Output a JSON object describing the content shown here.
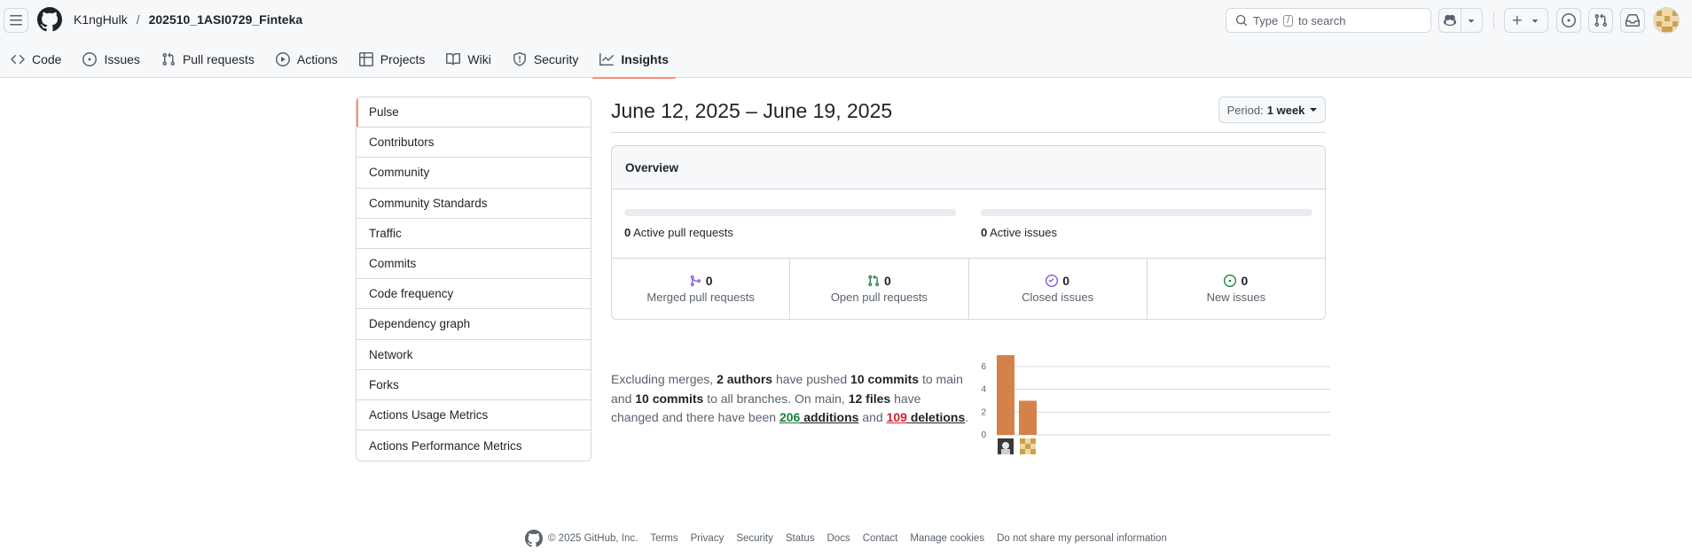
{
  "header": {
    "owner": "K1ngHulk",
    "separator": "/",
    "repo": "202510_1ASI0729_Finteka",
    "search_prefix": "Type",
    "search_key": "/",
    "search_suffix": "to search"
  },
  "tabs": [
    {
      "label": "Code",
      "icon": "code-icon"
    },
    {
      "label": "Issues",
      "icon": "issue-opened-icon"
    },
    {
      "label": "Pull requests",
      "icon": "git-pull-request-icon"
    },
    {
      "label": "Actions",
      "icon": "play-icon"
    },
    {
      "label": "Projects",
      "icon": "table-icon"
    },
    {
      "label": "Wiki",
      "icon": "book-icon"
    },
    {
      "label": "Security",
      "icon": "shield-icon"
    },
    {
      "label": "Insights",
      "icon": "graph-icon",
      "selected": true
    }
  ],
  "sidebar": {
    "items": [
      {
        "label": "Pulse",
        "selected": true
      },
      {
        "label": "Contributors"
      },
      {
        "label": "Community"
      },
      {
        "label": "Community Standards"
      },
      {
        "label": "Traffic"
      },
      {
        "label": "Commits"
      },
      {
        "label": "Code frequency"
      },
      {
        "label": "Dependency graph"
      },
      {
        "label": "Network"
      },
      {
        "label": "Forks"
      },
      {
        "label": "Actions Usage Metrics"
      },
      {
        "label": "Actions Performance Metrics"
      }
    ]
  },
  "main": {
    "date_range": "June 12, 2025 – June 19, 2025",
    "period_label": "Period:",
    "period_value": "1 week",
    "overview": {
      "title": "Overview",
      "active_pull_requests": {
        "count": "0",
        "label": "Active pull requests",
        "fraction": 0
      },
      "active_issues": {
        "count": "0",
        "label": "Active issues",
        "fraction": 0
      },
      "stats": {
        "merged": {
          "count": "0",
          "label": "Merged pull requests"
        },
        "open": {
          "count": "0",
          "label": "Open pull requests"
        },
        "closed": {
          "count": "0",
          "label": "Closed issues"
        },
        "new": {
          "count": "0",
          "label": "New issues"
        }
      }
    },
    "summary": {
      "t1": "Excluding merges,",
      "authors": "2 authors",
      "t2": "have pushed",
      "commits_main": "10 commits",
      "t3": "to main and",
      "commits_all": "10 commits",
      "t4": "to all branches. On main,",
      "files": "12 files",
      "t5": "have changed and there have been",
      "additions_num": "206",
      "additions_word": "additions",
      "t6": "and",
      "deletions_num": "109",
      "deletions_word": "deletions",
      "t7": "."
    }
  },
  "chart_data": {
    "type": "bar",
    "categories": [
      "author-1",
      "author-2"
    ],
    "values": [
      7,
      3
    ],
    "ylim": [
      0,
      7
    ],
    "yticks": [
      "0",
      "2",
      "4",
      "6"
    ],
    "bar_color": "#d4824a",
    "grid": true
  },
  "footer": {
    "copyright": "© 2025 GitHub, Inc.",
    "links": [
      "Terms",
      "Privacy",
      "Security",
      "Status",
      "Docs",
      "Contact",
      "Manage cookies",
      "Do not share my personal information"
    ]
  },
  "colors": {
    "accent_underline": "#fd8c73",
    "merged": "#8250df",
    "open": "#1a7f37",
    "closed": "#8250df",
    "new": "#1a7f37",
    "additions": "#1a7f37",
    "deletions": "#cf222e"
  }
}
